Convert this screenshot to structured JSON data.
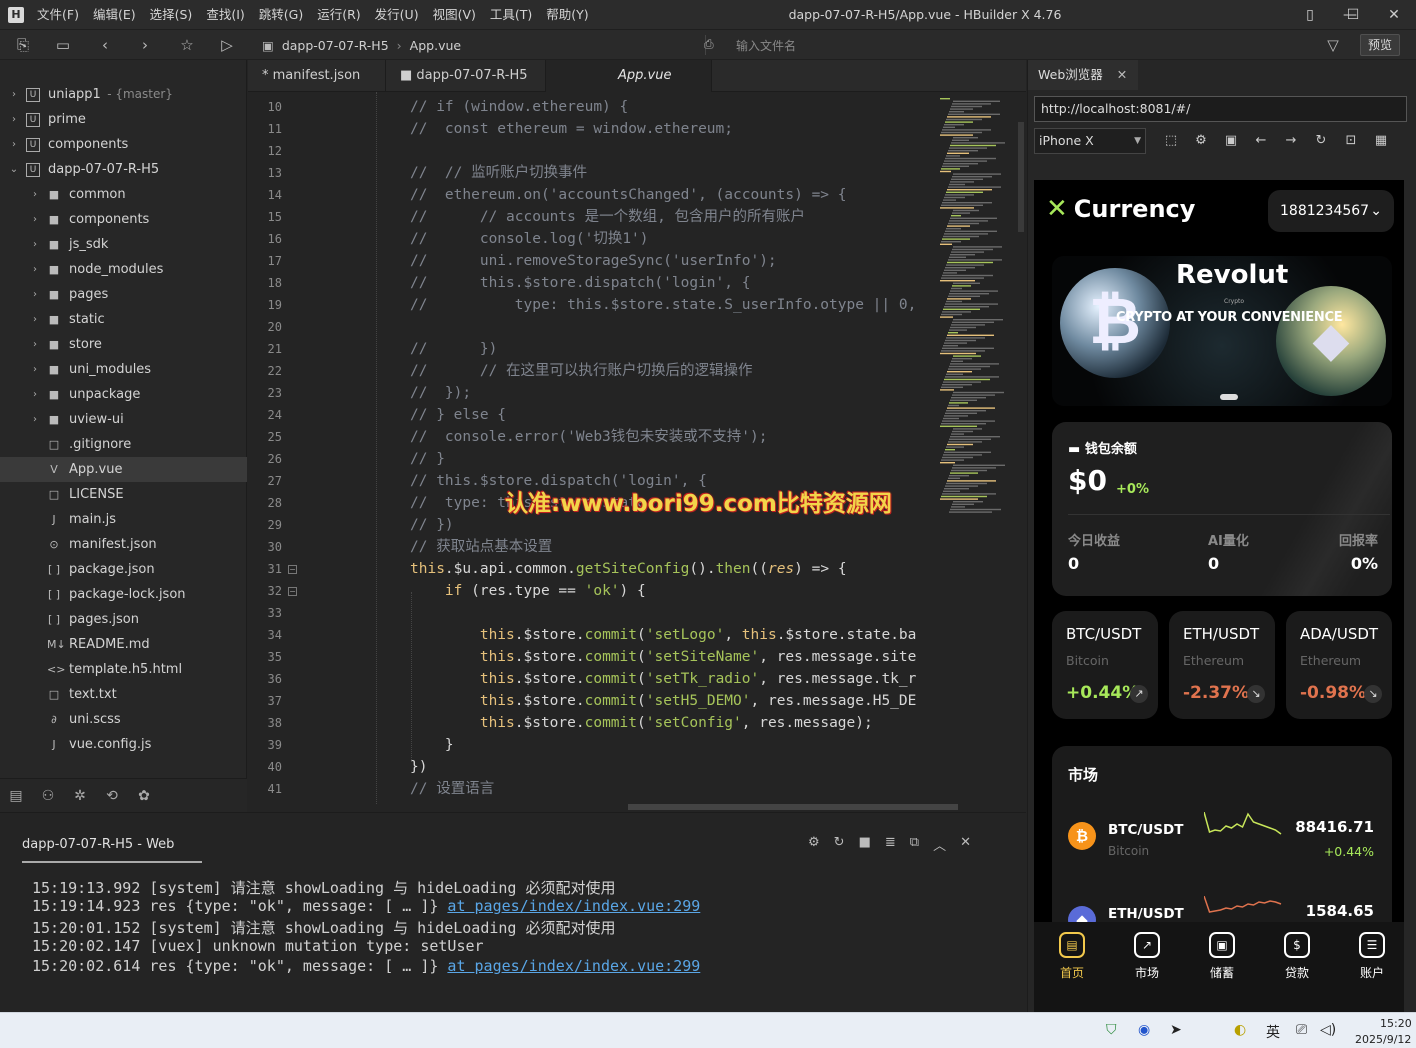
{
  "window": {
    "title": "dapp-07-07-R-H5/App.vue - HBuilder X 4.76",
    "menu": [
      "文件(F)",
      "编辑(E)",
      "选择(S)",
      "查找(I)",
      "跳转(G)",
      "运行(R)",
      "发行(U)",
      "视图(V)",
      "工具(T)",
      "帮助(Y)"
    ]
  },
  "toolbar": {
    "breadcrumb": [
      "dapp-07-07-R-H5",
      "App.vue"
    ],
    "file_search_placeholder": "输入文件名",
    "preview_label": "预览"
  },
  "sidebar": {
    "items": [
      {
        "label": "uniapp1",
        "extra": "- {master}",
        "level": 0,
        "type": "project"
      },
      {
        "label": "prime",
        "extra": "",
        "level": 0,
        "type": "project"
      },
      {
        "label": "components",
        "extra": "",
        "level": 0,
        "type": "project"
      },
      {
        "label": "dapp-07-07-R-H5",
        "extra": "",
        "level": 0,
        "type": "project-open"
      },
      {
        "label": "common",
        "extra": "",
        "level": 1,
        "type": "folder"
      },
      {
        "label": "components",
        "extra": "",
        "level": 1,
        "type": "folder"
      },
      {
        "label": "js_sdk",
        "extra": "",
        "level": 1,
        "type": "folder"
      },
      {
        "label": "node_modules",
        "extra": "",
        "level": 1,
        "type": "folder"
      },
      {
        "label": "pages",
        "extra": "",
        "level": 1,
        "type": "folder"
      },
      {
        "label": "static",
        "extra": "",
        "level": 1,
        "type": "folder"
      },
      {
        "label": "store",
        "extra": "",
        "level": 1,
        "type": "folder"
      },
      {
        "label": "uni_modules",
        "extra": "",
        "level": 1,
        "type": "folder"
      },
      {
        "label": "unpackage",
        "extra": "",
        "level": 1,
        "type": "folder"
      },
      {
        "label": "uview-ui",
        "extra": "",
        "level": 1,
        "type": "folder"
      },
      {
        "label": ".gitignore",
        "extra": "",
        "level": 1,
        "type": "file"
      },
      {
        "label": "App.vue",
        "extra": "",
        "level": 1,
        "type": "vue"
      },
      {
        "label": "LICENSE",
        "extra": "",
        "level": 1,
        "type": "file"
      },
      {
        "label": "main.js",
        "extra": "",
        "level": 1,
        "type": "js"
      },
      {
        "label": "manifest.json",
        "extra": "",
        "level": 1,
        "type": "manifest"
      },
      {
        "label": "package.json",
        "extra": "",
        "level": 1,
        "type": "json"
      },
      {
        "label": "package-lock.json",
        "extra": "",
        "level": 1,
        "type": "json"
      },
      {
        "label": "pages.json",
        "extra": "",
        "level": 1,
        "type": "json"
      },
      {
        "label": "README.md",
        "extra": "",
        "level": 1,
        "type": "md"
      },
      {
        "label": "template.h5.html",
        "extra": "",
        "level": 1,
        "type": "html"
      },
      {
        "label": "text.txt",
        "extra": "",
        "level": 1,
        "type": "file"
      },
      {
        "label": "uni.scss",
        "extra": "",
        "level": 1,
        "type": "scss"
      },
      {
        "label": "vue.config.js",
        "extra": "",
        "level": 1,
        "type": "js"
      }
    ]
  },
  "tabs": [
    "* manifest.json",
    "dapp-07-07-R-H5",
    "App.vue"
  ],
  "editor": {
    "lines": [
      {
        "n": 10,
        "html": "<span class='c'>// if (window.ethereum) {</span>"
      },
      {
        "n": 11,
        "html": "<span class='c'>//  const ethereum = window.ethereum;</span>"
      },
      {
        "n": 12,
        "html": ""
      },
      {
        "n": 13,
        "html": "<span class='c'>//  // 监听账户切换事件</span>"
      },
      {
        "n": 14,
        "html": "<span class='c'>//  ethereum.on('accountsChanged', (accounts) =&gt; {</span>"
      },
      {
        "n": 15,
        "html": "<span class='c'>//      // accounts 是一个数组, 包含用户的所有账户</span>"
      },
      {
        "n": 16,
        "html": "<span class='c'>//      console.log('切换1')</span>"
      },
      {
        "n": 17,
        "html": "<span class='c'>//      uni.removeStorageSync('userInfo');</span>"
      },
      {
        "n": 18,
        "html": "<span class='c'>//      this.$store.dispatch('login', {</span>"
      },
      {
        "n": 19,
        "html": "<span class='c'>//          type: this.$store.state.S_userInfo.otype || 0,</span>"
      },
      {
        "n": 20,
        "html": ""
      },
      {
        "n": 21,
        "html": "<span class='c'>//      })</span>"
      },
      {
        "n": 22,
        "html": "<span class='c'>//      // 在这里可以执行账户切换后的逻辑操作</span>"
      },
      {
        "n": 23,
        "html": "<span class='c'>//  });</span>"
      },
      {
        "n": 24,
        "html": "<span class='c'>// } else {</span>"
      },
      {
        "n": 25,
        "html": "<span class='c'>//  console.error('Web3钱包未安装或不支持');</span>"
      },
      {
        "n": 26,
        "html": "<span class='c'>// }</span>"
      },
      {
        "n": 27,
        "html": "<span class='c'>// this.$store.dispatch('login', {</span>"
      },
      {
        "n": 28,
        "html": "<span class='c'>//  type: this.$store.state.</span>"
      },
      {
        "n": 29,
        "html": "<span class='c'>// })</span>"
      },
      {
        "n": 30,
        "html": "<span class='c'>// 获取站点基本设置</span>"
      },
      {
        "n": 31,
        "html": "<span class='kw'>this</span><span class='p'>.$u.api.common.</span><span class='mth'>getSiteConfig</span><span class='p'>().</span><span class='mth'>then</span><span class='p'>((</span><span class='ar'>res</span><span class='p'>) =&gt; {</span>"
      },
      {
        "n": 32,
        "html": "    <span class='kw'>if</span><span class='p'> (res.type == </span><span class='str'>'ok'</span><span class='p'>) {</span>"
      },
      {
        "n": 33,
        "html": ""
      },
      {
        "n": 34,
        "html": "        <span class='kw'>this</span><span class='p'>.$store.</span><span class='mth'>commit</span><span class='p'>(</span><span class='str'>'setLogo'</span><span class='p'>, </span><span class='kw'>this</span><span class='p'>.$store.state.ba</span>"
      },
      {
        "n": 35,
        "html": "        <span class='kw'>this</span><span class='p'>.$store.</span><span class='mth'>commit</span><span class='p'>(</span><span class='str'>'setSiteName'</span><span class='p'>, res.message.site</span>"
      },
      {
        "n": 36,
        "html": "        <span class='kw'>this</span><span class='p'>.$store.</span><span class='mth'>commit</span><span class='p'>(</span><span class='str'>'setTk_radio'</span><span class='p'>, res.message.tk_r</span>"
      },
      {
        "n": 37,
        "html": "        <span class='kw'>this</span><span class='p'>.$store.</span><span class='mth'>commit</span><span class='p'>(</span><span class='str'>'setH5_DEMO'</span><span class='p'>, res.message.H5_DE</span>"
      },
      {
        "n": 38,
        "html": "        <span class='kw'>this</span><span class='p'>.$store.</span><span class='mth'>commit</span><span class='p'>(</span><span class='str'>'setConfig'</span><span class='p'>, res.message);</span>"
      },
      {
        "n": 39,
        "html": "    <span class='p'>}</span>"
      },
      {
        "n": 40,
        "html": "<span class='p'>})</span>"
      },
      {
        "n": 41,
        "html": "<span class='c'>// 设置语言</span>"
      }
    ]
  },
  "watermark": "认准:www.bori99.com比特资源网",
  "console": {
    "title": "dapp-07-07-R-H5 - Web",
    "logs": [
      {
        "time": "15:19:13.992",
        "text": "[system] 请注意 showLoading 与 hideLoading 必须配对使用",
        "link": ""
      },
      {
        "time": "15:19:14.923",
        "text": "res {type: \"ok\", message: [ … ]}",
        "link": "at pages/index/index.vue:299"
      },
      {
        "time": "15:20:01.152",
        "text": "[system] 请注意 showLoading 与 hideLoading 必须配对使用",
        "link": ""
      },
      {
        "time": "15:20:02.147",
        "text": "[vuex] unknown mutation type: setUser",
        "link": ""
      },
      {
        "time": "15:20:02.614",
        "text": "res {type: \"ok\", message: [ … ]}",
        "link": "at pages/index/index.vue:299"
      }
    ]
  },
  "browser": {
    "tab_label": "Web浏览器",
    "url": "http://localhost:8081/#/",
    "device": "iPhone X"
  },
  "app": {
    "logo_text": "Currency",
    "account": "1881234567",
    "banner": {
      "brand": "Revolut",
      "headline": "CRYPTO AT YOUR CONVENIENCE",
      "small": "Crypto"
    },
    "wallet": {
      "title": "钱包余额",
      "amount": "$0",
      "change": "+0%",
      "stats": [
        {
          "label": "今日收益",
          "value": "0"
        },
        {
          "label": "AI量化",
          "value": "0"
        },
        {
          "label": "回报率",
          "value": "0%"
        }
      ]
    },
    "tickers": [
      {
        "pair": "BTC/USDT",
        "name": "Bitcoin",
        "change": "+0.44%",
        "color": "#a7e85a",
        "dir": "↗"
      },
      {
        "pair": "ETH/USDT",
        "name": "Ethereum",
        "change": "-2.37%",
        "color": "#e0734e",
        "dir": "↘"
      },
      {
        "pair": "ADA/USDT",
        "name": "Ethereum",
        "change": "-0.98%",
        "color": "#e0734e",
        "dir": "↘"
      }
    ],
    "market": {
      "title": "市场",
      "rows": [
        {
          "pair": "BTC/USDT",
          "name": "Bitcoin",
          "price": "88416.71",
          "change": "+0.44%",
          "coin": "₿",
          "coin_color": "#f7931a",
          "line_color": "#c8e65a"
        },
        {
          "pair": "ETH/USDT",
          "name": "",
          "price": "1584.65",
          "change": "",
          "coin": "◆",
          "coin_color": "#5a6bd8",
          "line_color": "#e0734e"
        }
      ]
    },
    "nav": [
      {
        "label": "首页",
        "active": true
      },
      {
        "label": "市场",
        "active": false
      },
      {
        "label": "储蓄",
        "active": false
      },
      {
        "label": "贷款",
        "active": false
      },
      {
        "label": "账户",
        "active": false
      }
    ]
  },
  "taskbar": {
    "ime": "英",
    "time": "15:20",
    "date": "2025/9/12"
  }
}
